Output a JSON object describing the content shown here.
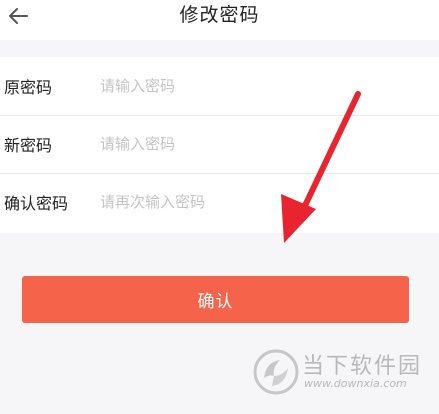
{
  "header": {
    "title": "修改密码",
    "back_icon": "arrow-left-icon"
  },
  "form": {
    "fields": [
      {
        "label": "原密码",
        "placeholder": "请输入密码",
        "value": ""
      },
      {
        "label": "新密码",
        "placeholder": "请输入密码",
        "value": ""
      },
      {
        "label": "确认密码",
        "placeholder": "请再次输入密码",
        "value": ""
      }
    ]
  },
  "actions": {
    "confirm_label": "确认"
  },
  "annotation": {
    "arrow_icon": "red-arrow-icon",
    "color": "#e8252e"
  },
  "watermark": {
    "name": "当下软件园",
    "url": "www.downxia.com"
  },
  "colors": {
    "accent": "#f5634a",
    "background": "#f6f6f8",
    "placeholder": "#c4c4c4"
  }
}
